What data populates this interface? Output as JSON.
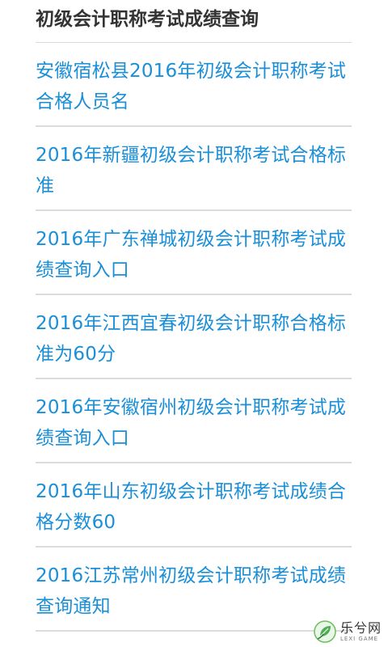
{
  "section": {
    "title": "初级会计职称考试成绩查询"
  },
  "articles": [
    {
      "title": "安徽宿松县2016年初级会计职称考试合格人员名"
    },
    {
      "title": "2016年新疆初级会计职称考试合格标准"
    },
    {
      "title": "2016年广东禅城初级会计职称考试成绩查询入口"
    },
    {
      "title": "2016年江西宜春初级会计职称合格标准为60分"
    },
    {
      "title": "2016年安徽宿州初级会计职称考试成绩查询入口"
    },
    {
      "title": "2016年山东初级会计职称考试成绩合格分数60"
    },
    {
      "title": "2016江苏常州初级会计职称考试成绩查询通知"
    }
  ],
  "watermark": {
    "name": "乐兮网",
    "subtitle": "LEXI GAME",
    "icon": "leaf-logo-icon"
  },
  "colors": {
    "link": "#1a8fd8",
    "title": "#333333",
    "divider": "#dcdcdc",
    "logo_green": "#4caf50"
  }
}
